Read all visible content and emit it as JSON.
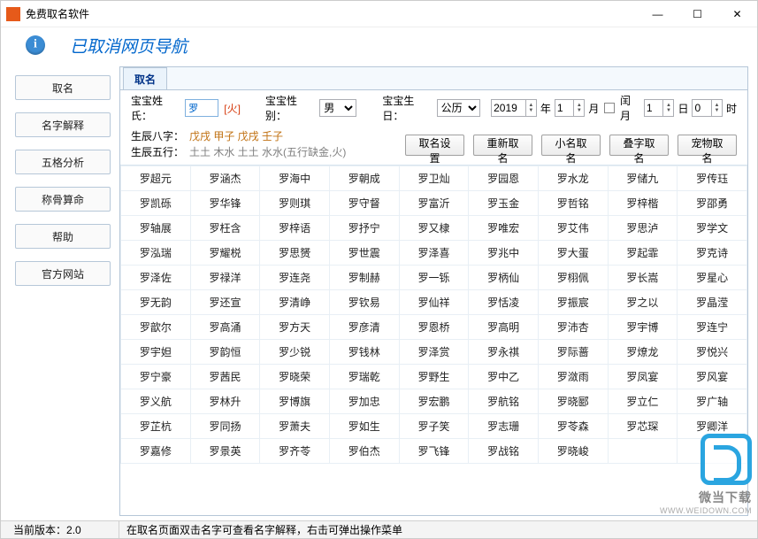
{
  "window": {
    "title": "免费取名软件",
    "minimize": "—",
    "maximize": "☐",
    "close": "✕"
  },
  "notice": "已取消网页导航",
  "sidebar": {
    "items": [
      {
        "label": "取名"
      },
      {
        "label": "名字解释"
      },
      {
        "label": "五格分析"
      },
      {
        "label": "称骨算命"
      },
      {
        "label": "帮助"
      },
      {
        "label": "官方网站"
      }
    ]
  },
  "tab": {
    "label": "取名"
  },
  "form": {
    "surname_label": "宝宝姓氏：",
    "surname_value": "罗",
    "surname_element": "[火]",
    "gender_label": "宝宝性别：",
    "gender_value": "男",
    "birth_label": "宝宝生日：",
    "calendar_value": "公历",
    "year": "2019",
    "year_suffix": "年",
    "month": "1",
    "month_suffix": "月",
    "leap_label": "闰月",
    "day": "1",
    "day_suffix": "日",
    "hour": "0",
    "hour_suffix": "时"
  },
  "bazi": {
    "bazi_label": "生辰八字：",
    "bazi_value": "戊戌 甲子 戊戌 壬子",
    "wuxing_label": "生辰五行：",
    "wuxing_value": "土土 木水 土土 水水(五行缺金,火)"
  },
  "buttons": {
    "settings": "取名设置",
    "rename": "重新取名",
    "nickname": "小名取名",
    "stack": "叠字取名",
    "pet": "宠物取名"
  },
  "names": [
    [
      "罗超元",
      "罗涵杰",
      "罗海中",
      "罗朝成",
      "罗卫灿",
      "罗园恩",
      "罗水龙",
      "罗储九",
      "罗传珏"
    ],
    [
      "罗凯砾",
      "罗华锋",
      "罗则琪",
      "罗守督",
      "罗富沂",
      "罗玉金",
      "罗哲铭",
      "罗梓楷",
      "罗邵勇"
    ],
    [
      "罗轴展",
      "罗枉含",
      "罗梓语",
      "罗抒宁",
      "罗又棣",
      "罗唯宏",
      "罗艾伟",
      "罗思泸",
      "罗学文"
    ],
    [
      "罗泓瑞",
      "罗耀棁",
      "罗思赟",
      "罗世震",
      "罗泽喜",
      "罗兆中",
      "罗大蛋",
      "罗起霏",
      "罗克诗"
    ],
    [
      "罗泽佐",
      "罗禄洋",
      "罗连尧",
      "罗制赫",
      "罗一铄",
      "罗柄仙",
      "罗栩佩",
      "罗长嵩",
      "罗星心"
    ],
    [
      "罗无韵",
      "罗还宣",
      "罗清峥",
      "罗钦易",
      "罗仙祥",
      "罗恬凌",
      "罗振宸",
      "罗之以",
      "罗晶滢"
    ],
    [
      "罗歆尔",
      "罗高涌",
      "罗方天",
      "罗彦清",
      "罗恩桥",
      "罗高明",
      "罗沛杏",
      "罗宇博",
      "罗连宁"
    ],
    [
      "罗宇妲",
      "罗韵恒",
      "罗少锐",
      "罗钱林",
      "罗泽赏",
      "罗永祺",
      "罗际蔷",
      "罗燎龙",
      "罗悦兴"
    ],
    [
      "罗宁豪",
      "罗茜民",
      "罗晓荣",
      "罗瑞乾",
      "罗野生",
      "罗中乙",
      "罗潋雨",
      "罗凤宴",
      "罗风宴"
    ],
    [
      "罗义航",
      "罗林升",
      "罗博旗",
      "罗加忠",
      "罗宏鹏",
      "罗航铭",
      "罗晓郾",
      "罗立仁",
      "罗广轴"
    ],
    [
      "罗芷杭",
      "罗同扬",
      "罗萧夫",
      "罗如生",
      "罗子笑",
      "罗志珊",
      "罗苓森",
      "罗芯琛",
      "罗卿洋"
    ],
    [
      "罗嘉修",
      "罗景英",
      "罗齐苓",
      "罗伯杰",
      "罗飞锋",
      "罗战铭",
      "罗晓峻",
      "",
      ""
    ]
  ],
  "status": {
    "version_label": "当前版本：",
    "version": "2.0",
    "hint": "在取名页面双击名字可查看名字解释，右击可弹出操作菜单"
  },
  "watermark": {
    "brand": "微当下载",
    "url": "WWW.WEIDOWN.COM"
  }
}
